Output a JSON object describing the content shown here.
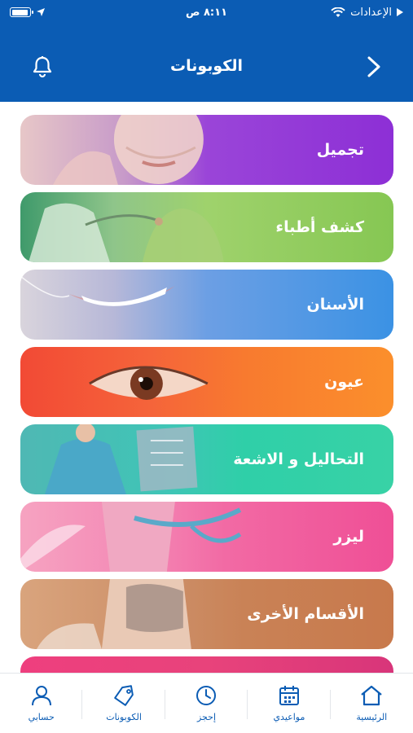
{
  "status_bar": {
    "carrier": "الإعدادات",
    "time": "٨:١١ ص",
    "battery_level": 0.95
  },
  "header": {
    "title": "الكوبونات",
    "bell_icon": "bell-icon",
    "back_icon": "chevron-right-icon",
    "background": "#0b5cb4"
  },
  "categories": [
    {
      "label": "تجميل"
    },
    {
      "label": "كشف أطباء"
    },
    {
      "label": "الأسنان"
    },
    {
      "label": "عيون"
    },
    {
      "label": "التحاليل و الاشعة"
    },
    {
      "label": "ليزر"
    },
    {
      "label": "الأقسام الأخرى"
    }
  ],
  "bottom_nav": {
    "items": [
      {
        "label": "الرئيسية",
        "icon": "home-icon"
      },
      {
        "label": "مواعيدي",
        "icon": "calendar-icon"
      },
      {
        "label": "إحجز",
        "icon": "clock-icon"
      },
      {
        "label": "الكوبونات",
        "icon": "tag-icon"
      },
      {
        "label": "حسابي",
        "icon": "user-icon"
      }
    ],
    "accent": "#0b5cb4"
  }
}
